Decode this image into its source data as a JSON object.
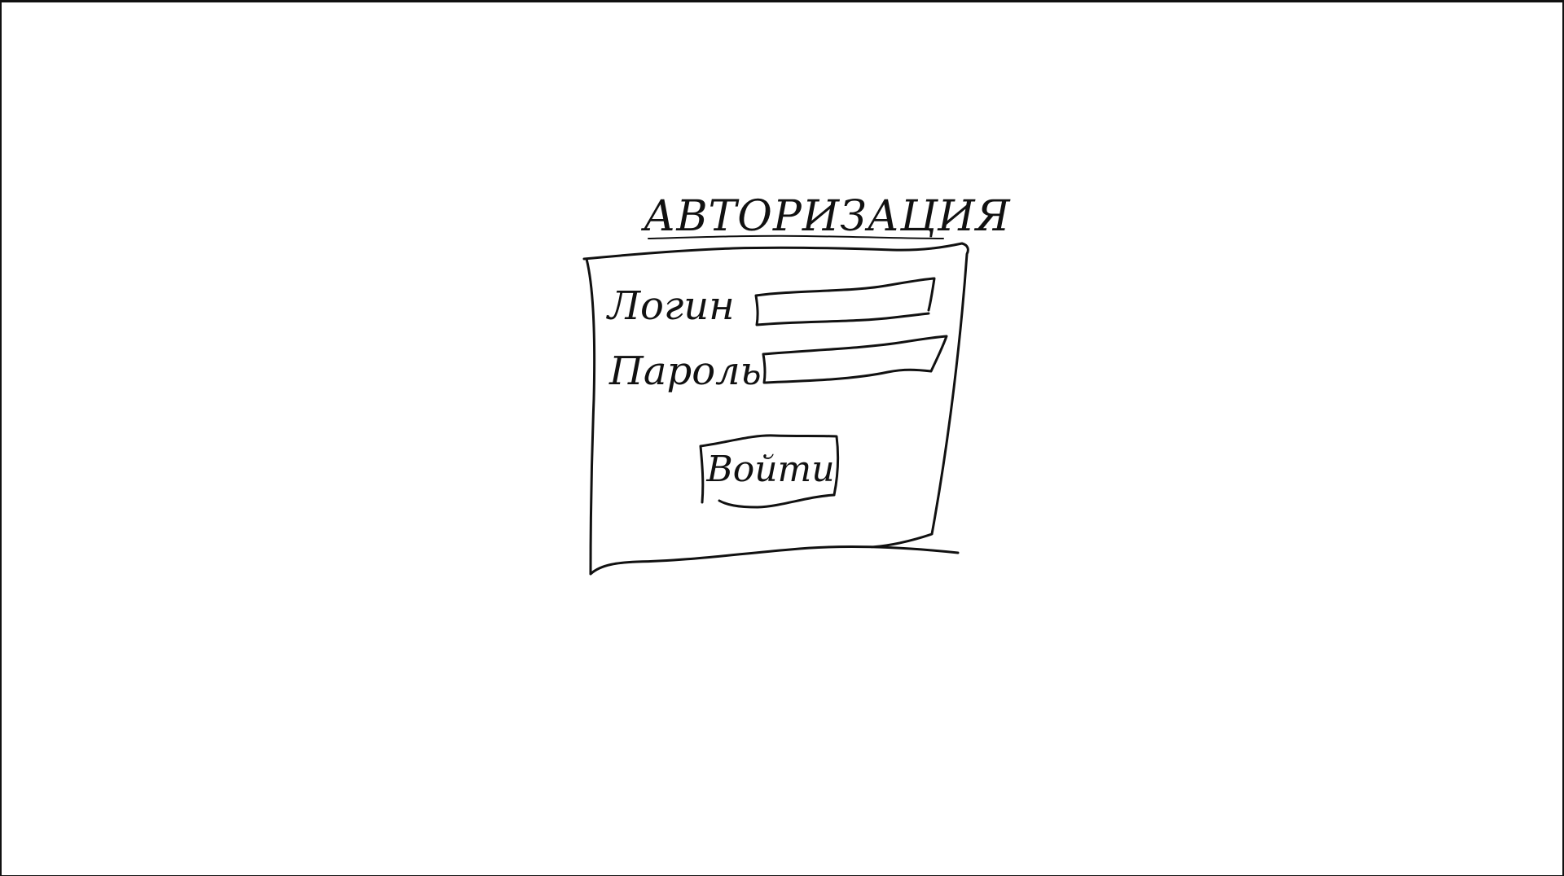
{
  "auth": {
    "title": "АВТОРИЗАЦИЯ",
    "login_label": "Логин",
    "password_label": "Пароль",
    "login_value": "",
    "password_value": "",
    "submit_label": "Войти"
  },
  "colors": {
    "background": "#ffffff",
    "ink": "#111111"
  }
}
